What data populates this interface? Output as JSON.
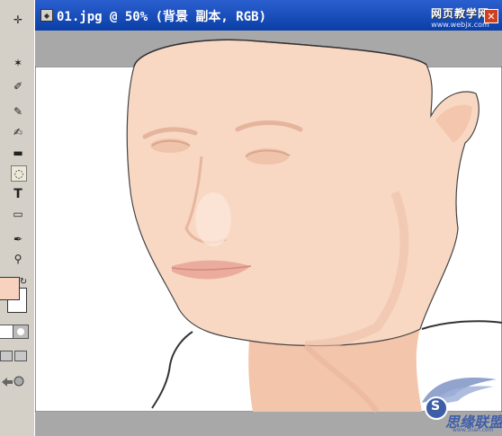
{
  "window": {
    "title": "01.jpg @ 50% (背景 副本, RGB)",
    "close_glyph": "✕",
    "accent_color": "#0a3fa6"
  },
  "toolbox": {
    "tools": [
      {
        "name": "move-tool",
        "glyph": "✛"
      },
      {
        "name": "magic-wand-tool",
        "glyph": "✶"
      },
      {
        "name": "slice-tool",
        "glyph": "✐"
      },
      {
        "name": "brush-tool",
        "glyph": "✎"
      },
      {
        "name": "history-brush-tool",
        "glyph": "✍"
      },
      {
        "name": "gradient-tool",
        "glyph": "▬"
      },
      {
        "name": "smudge-tool",
        "glyph": "◌"
      },
      {
        "name": "type-tool",
        "glyph": "T"
      },
      {
        "name": "shape-tool",
        "glyph": "▭"
      },
      {
        "name": "eyedropper-tool",
        "glyph": "✒"
      },
      {
        "name": "zoom-tool",
        "glyph": "⚲"
      }
    ],
    "foreground_color": "#f6d2bf",
    "background_color": "#ffffff",
    "swap_glyph": "↻"
  },
  "watermark": {
    "top_line1": "网页教学网",
    "top_line2": "www.webjx.com",
    "bottom_text": "思缘联盟",
    "bottom_sub": "www.3lian.com",
    "badge_letter": "S"
  }
}
